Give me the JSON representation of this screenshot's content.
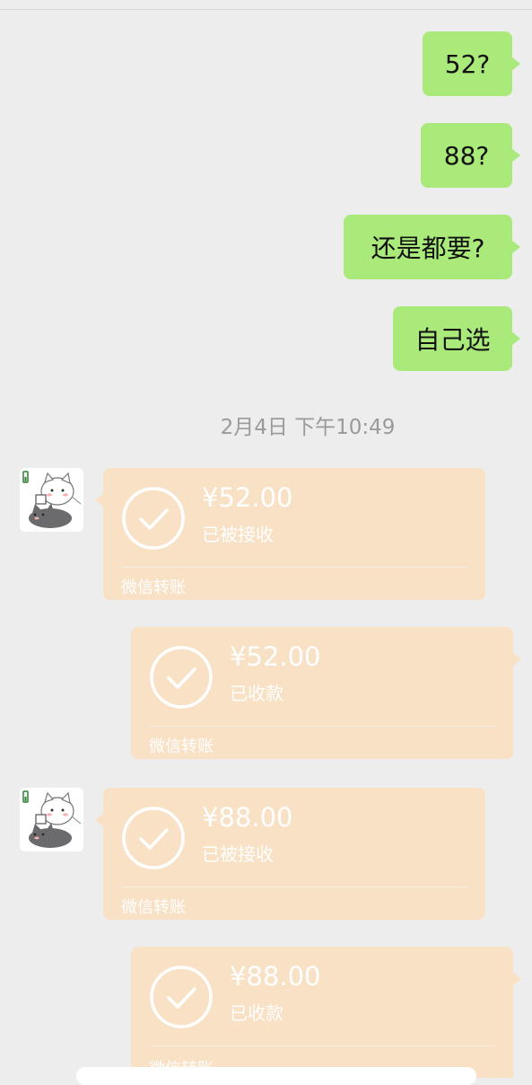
{
  "messages": [
    {
      "text": "52?"
    },
    {
      "text": "88?"
    },
    {
      "text": "还是都要?"
    },
    {
      "text": "自己选"
    }
  ],
  "timestamp": "2月4日 下午10:49",
  "transfers": [
    {
      "amount": "¥52.00",
      "status": "已被接收",
      "brand": "微信转账"
    },
    {
      "amount": "¥52.00",
      "status": "已收款",
      "brand": "微信转账"
    },
    {
      "amount": "¥88.00",
      "status": "已被接收",
      "brand": "微信转账"
    },
    {
      "amount": "¥88.00",
      "status": "已收款",
      "brand": "微信转账"
    }
  ],
  "colors": {
    "background": "#ededed",
    "bubble_green": "#a9ea7a",
    "transfer_card": "#f8e1c5",
    "timestamp_text": "#9a9a9a"
  },
  "icons": [
    "check-circle-icon",
    "cat-sticker-avatar"
  ]
}
